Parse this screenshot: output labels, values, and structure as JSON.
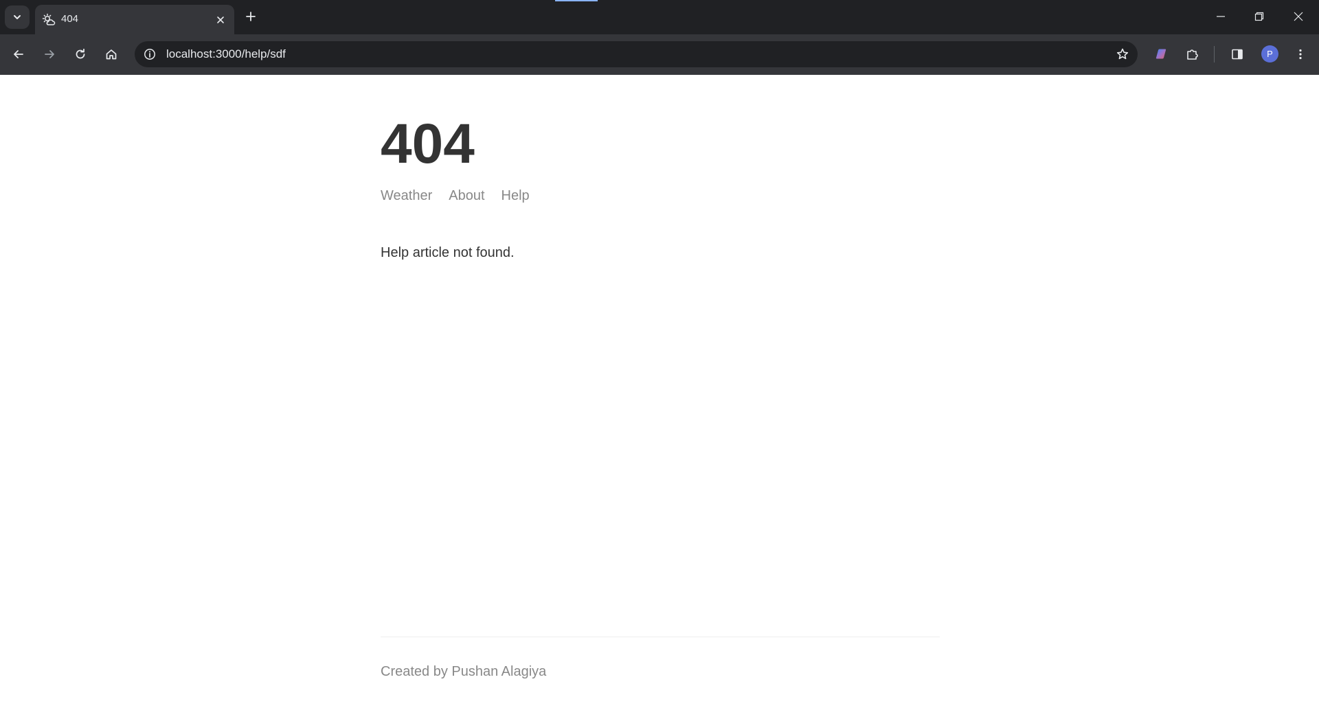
{
  "browser": {
    "tab": {
      "title": "404",
      "favicon": "weather-sun-cloud-icon"
    },
    "omnibox": {
      "url": "localhost:3000/help/sdf"
    },
    "profile": {
      "initial": "P",
      "color": "#5b6fd8"
    },
    "chrome_colors": {
      "tabstrip": "#202124",
      "toolbar": "#35363a",
      "omnibox": "#202124",
      "text": "#e8eaed"
    }
  },
  "page": {
    "title": "404",
    "nav": [
      {
        "label": "Weather"
      },
      {
        "label": "About"
      },
      {
        "label": "Help"
      }
    ],
    "message": "Help article not found.",
    "footer": "Created by Pushan Alagiya",
    "colors": {
      "heading": "#333333",
      "muted": "#888888",
      "divider": "#eeeeee"
    }
  }
}
